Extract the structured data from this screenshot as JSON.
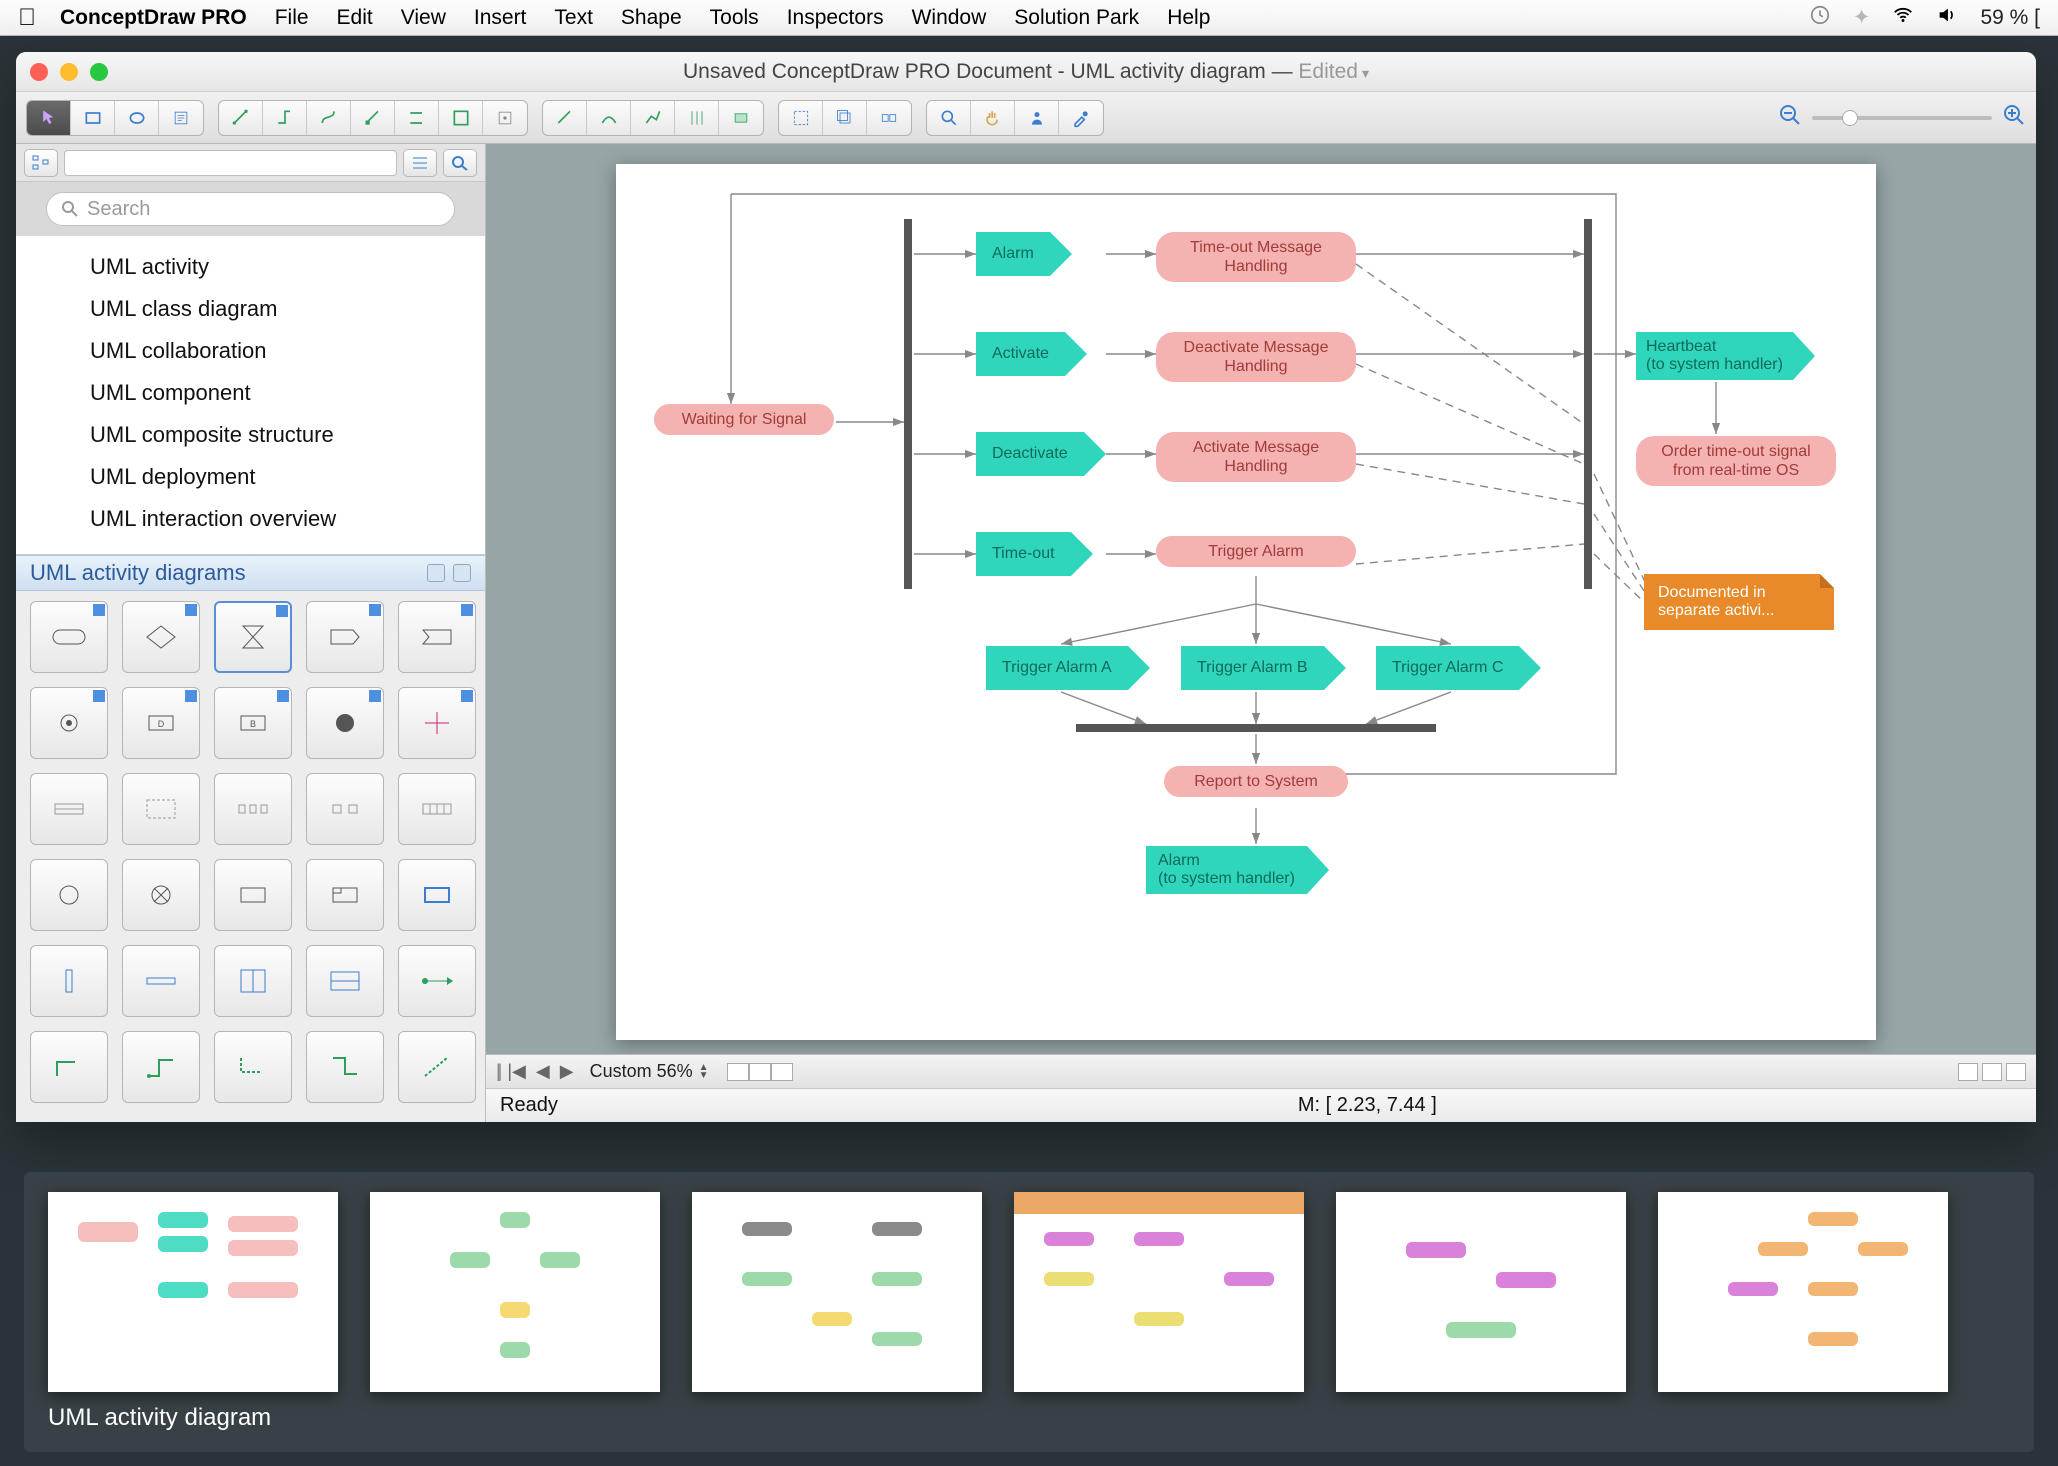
{
  "menubar": {
    "app": "ConceptDraw PRO",
    "items": [
      "File",
      "Edit",
      "View",
      "Insert",
      "Text",
      "Shape",
      "Tools",
      "Inspectors",
      "Window",
      "Solution Park",
      "Help"
    ],
    "battery": "59 % ["
  },
  "window": {
    "title_left": "Unsaved ConceptDraw PRO Document - UML activity diagram — ",
    "title_edited": "Edited"
  },
  "sidebar": {
    "search_placeholder": "Search",
    "tree": [
      "UML activity",
      "UML class diagram",
      "UML collaboration",
      "UML component",
      "UML composite structure",
      "UML deployment",
      "UML interaction overview"
    ],
    "stencil_title": "UML activity diagrams"
  },
  "diagram": {
    "wait": "Waiting for Signal",
    "alarm": "Alarm",
    "activate": "Activate",
    "deactivate": "Deactivate",
    "timeout": "Time-out",
    "pill_timeout": "Time-out Message Handling",
    "pill_deact": "Deactivate Message Handling",
    "pill_act": "Activate Message Handling",
    "pill_trigger": "Trigger Alarm",
    "trig_a": "Trigger Alarm A",
    "trig_b": "Trigger Alarm B",
    "trig_c": "Trigger Alarm C",
    "report": "Report to System",
    "alarm_handler": "Alarm\n(to system handler)",
    "heartbeat": "Heartbeat\n(to system handler)",
    "pill_order": "Order time-out signal from real-time OS",
    "note": "Documented in separate activi..."
  },
  "pgctrl": {
    "zoom": "Custom 56%"
  },
  "status": {
    "ready": "Ready",
    "mouse": "M: [ 2.23, 7.44 ]"
  },
  "gallery": {
    "caption": "UML activity diagram"
  }
}
